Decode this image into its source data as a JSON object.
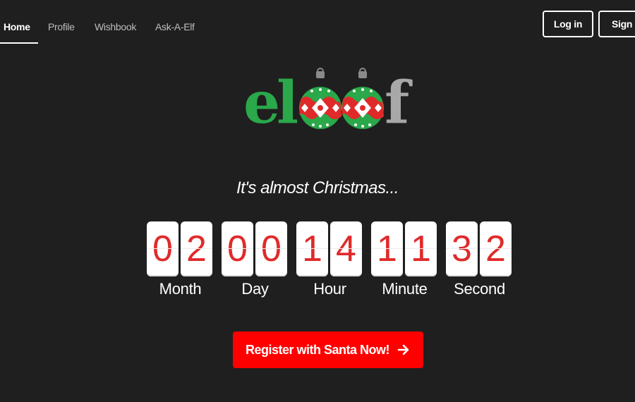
{
  "nav": {
    "items": [
      {
        "label": "Home",
        "active": true
      },
      {
        "label": "Profile",
        "active": false
      },
      {
        "label": "Wishbook",
        "active": false
      },
      {
        "label": "Ask-A-Elf",
        "active": false
      }
    ],
    "login_label": "Log in",
    "signup_label": "Sign Up"
  },
  "logo": {
    "text": "eloof",
    "colors": {
      "e_l": "#2aa84a",
      "f": "#a8a8a8",
      "ornament_green": "#2aa84a",
      "ornament_red": "#e02a2a"
    }
  },
  "tagline": "It's almost Christmas...",
  "countdown": [
    {
      "label": "Month",
      "d1": "0",
      "d2": "2"
    },
    {
      "label": "Day",
      "d1": "0",
      "d2": "0"
    },
    {
      "label": "Hour",
      "d1": "1",
      "d2": "4"
    },
    {
      "label": "Minute",
      "d1": "1",
      "d2": "1"
    },
    {
      "label": "Second",
      "d1": "3",
      "d2": "2"
    }
  ],
  "cta": {
    "label": "Register with Santa Now!",
    "icon": "arrow-right-icon",
    "color": "#ff0000"
  },
  "colors": {
    "background": "#1f1f1f",
    "digit_text": "#e02a2a"
  }
}
